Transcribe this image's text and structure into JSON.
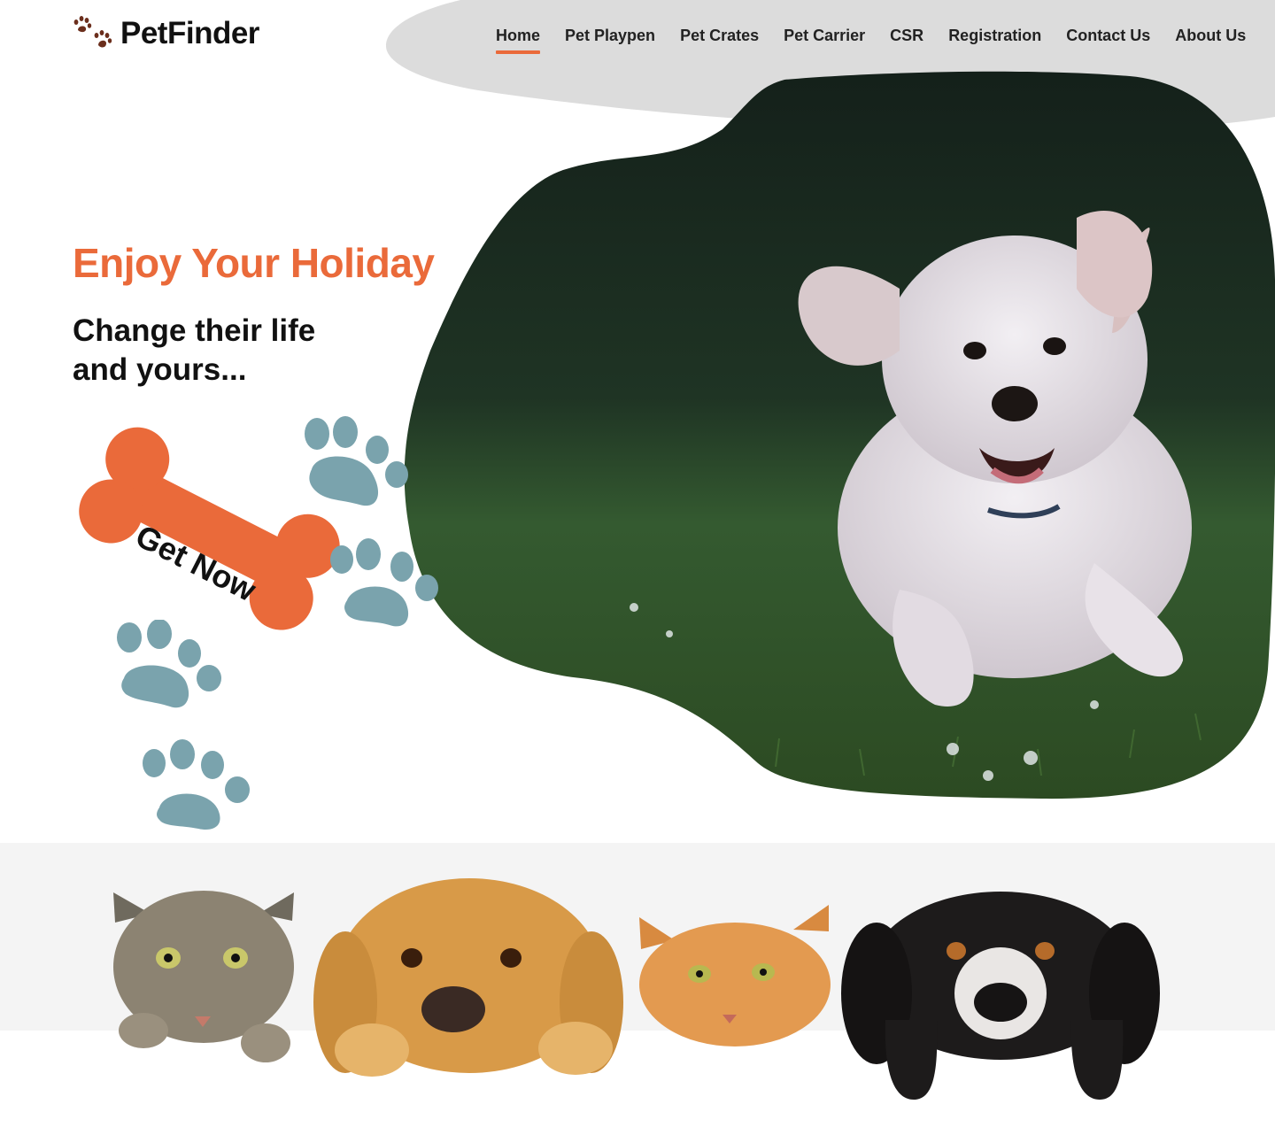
{
  "brand": {
    "name": "PetFinder",
    "logo_icon": "paw-prints-icon"
  },
  "nav": {
    "items": [
      {
        "label": "Home",
        "active": true
      },
      {
        "label": "Pet Playpen",
        "active": false
      },
      {
        "label": "Pet Crates",
        "active": false
      },
      {
        "label": "Pet Carrier",
        "active": false
      },
      {
        "label": "CSR",
        "active": false
      },
      {
        "label": "Registration",
        "active": false
      },
      {
        "label": "Contact Us",
        "active": false
      },
      {
        "label": "About Us",
        "active": false
      }
    ]
  },
  "hero": {
    "title": "Enjoy Your Holiday",
    "subtitle": "Change their life and yours...",
    "cta_label": "Get Now",
    "image": "running-white-dog-photo"
  },
  "banner": {
    "image": "cats-and-dogs-peeking-photo"
  },
  "colors": {
    "accent": "#ea6a3a",
    "paw": "#7aa3ad",
    "header_blob": "#dcdcdc",
    "logo_paw": "#6b2e1c"
  }
}
